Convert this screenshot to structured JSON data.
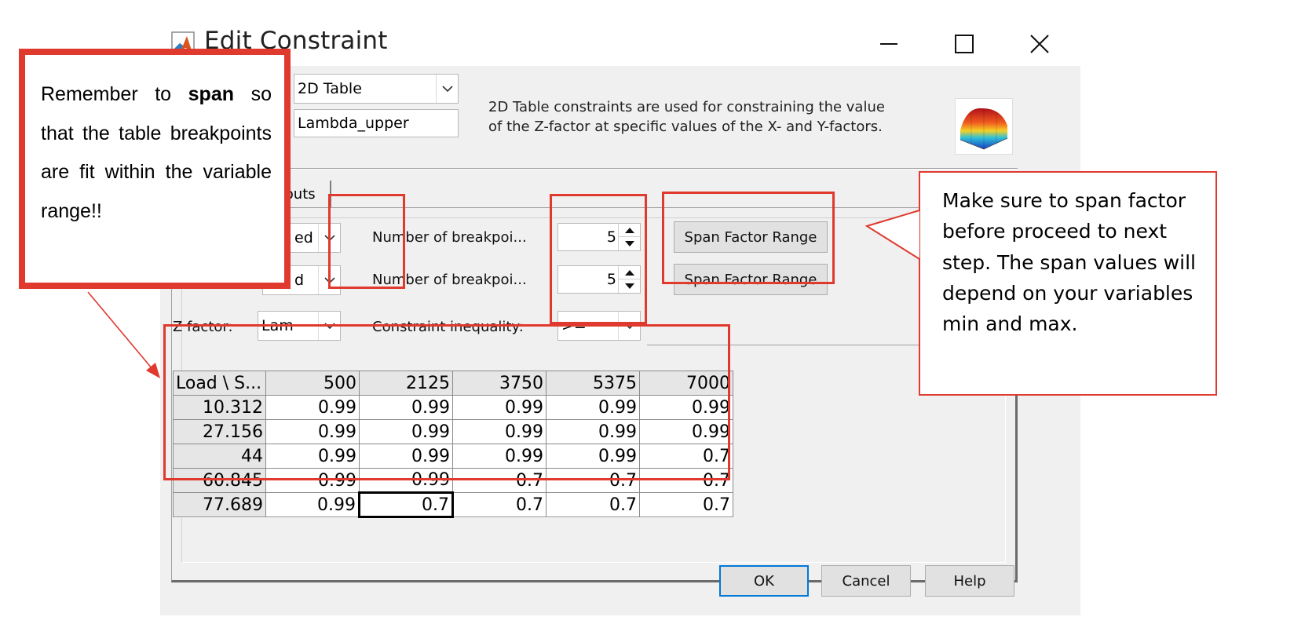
{
  "window": {
    "title": "Edit Constraint"
  },
  "header": {
    "type_combo_value": "2D Table",
    "name_value": "Lambda_upper",
    "description_line1": "2D Table constraints are used for constraining the value",
    "description_line2": "of the Z-factor at specific values of the X- and Y-factors."
  },
  "tab": {
    "partial_label": "puts"
  },
  "factors": {
    "x_factor_partial": "ed",
    "y_factor_partial": "d",
    "z_factor_label": "Z factor:",
    "z_factor_value": "Lam",
    "breakpoints_label_1": "Number of breakpoi...",
    "breakpoints_label_2": "Number of breakpoi...",
    "breakpoints_value_1": "5",
    "breakpoints_value_2": "5",
    "span_button_1": "Span Factor Range",
    "span_button_2": "Span Factor Range",
    "inequality_label": "Constraint inequality:",
    "inequality_value": ">="
  },
  "table": {
    "corner": "Load \\ S...",
    "columns": [
      "500",
      "2125",
      "3750",
      "5375",
      "7000"
    ],
    "rows": [
      {
        "head": "10.312",
        "cells": [
          "0.99",
          "0.99",
          "0.99",
          "0.99",
          "0.99"
        ]
      },
      {
        "head": "27.156",
        "cells": [
          "0.99",
          "0.99",
          "0.99",
          "0.99",
          "0.99"
        ]
      },
      {
        "head": "44",
        "cells": [
          "0.99",
          "0.99",
          "0.99",
          "0.99",
          "0.7"
        ]
      },
      {
        "head": "60.845",
        "cells": [
          "0.99",
          "0.99",
          "0.7",
          "0.7",
          "0.7"
        ]
      },
      {
        "head": "77.689",
        "cells": [
          "0.99",
          "0.7",
          "0.7",
          "0.7",
          "0.7"
        ]
      }
    ],
    "selected_cell": {
      "row": 4,
      "col": 1
    }
  },
  "buttons": {
    "ok": "OK",
    "cancel": "Cancel",
    "help": "Help"
  },
  "annotations": {
    "left_note_before": "Remember to ",
    "left_note_bold": "span",
    "left_note_after": " so that the table breakpoints are fit within the variable range!!",
    "right_note": "Make sure to span factor before proceed to next step. The span values will depend on your variables min and max.",
    "accent_color": "#e0392e"
  },
  "icons": {
    "app": "matlab-icon",
    "surface": "surface-plot-icon"
  }
}
